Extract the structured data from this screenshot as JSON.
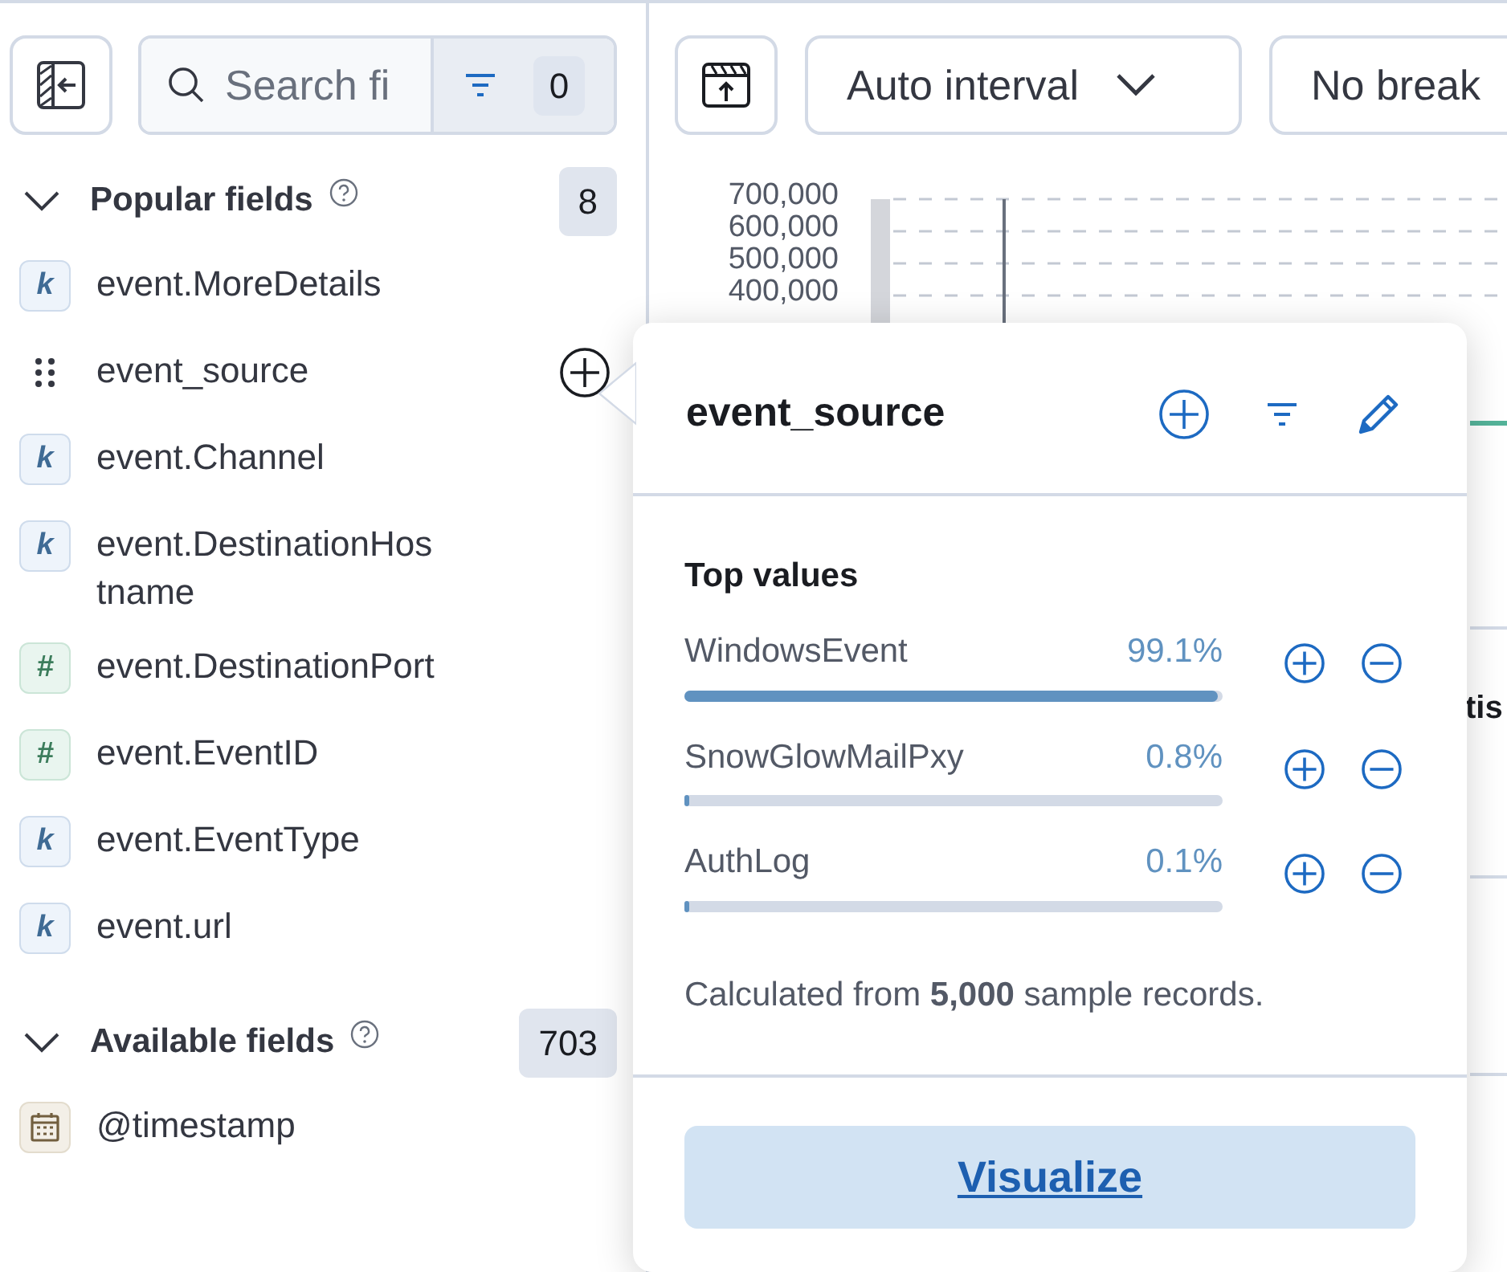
{
  "sidebar": {
    "search": {
      "placeholder": "Search fi"
    },
    "filter_count": "0",
    "sections": [
      {
        "title": "Popular fields",
        "count": "8",
        "expanded": true,
        "fields": [
          {
            "name": "event.MoreDetails",
            "kind": "keyword",
            "type_label": "k",
            "hovered": false
          },
          {
            "name": "event_source",
            "hovered": true
          },
          {
            "name": "event.Channel",
            "kind": "keyword",
            "type_label": "k",
            "hovered": false
          },
          {
            "name": "event.DestinationHostname",
            "kind": "keyword",
            "type_label": "k",
            "hovered": false
          },
          {
            "name": "event.DestinationPort",
            "kind": "number",
            "type_label": "#",
            "hovered": false
          },
          {
            "name": "event.EventID",
            "kind": "number",
            "type_label": "#",
            "hovered": false
          },
          {
            "name": "event.EventType",
            "kind": "keyword",
            "type_label": "k",
            "hovered": false
          },
          {
            "name": "event.url",
            "kind": "keyword",
            "type_label": "k",
            "hovered": false
          }
        ]
      },
      {
        "title": "Available fields",
        "count": "703",
        "expanded": true,
        "fields": [
          {
            "name": "@timestamp",
            "kind": "date",
            "hovered": false
          }
        ]
      }
    ]
  },
  "toolbar": {
    "interval": "Auto interval",
    "breakdown": "No break"
  },
  "chart": {
    "y_axis_labels": [
      "700,000",
      "600,000",
      "500,000",
      "400,000"
    ]
  },
  "background_fragment": "tis",
  "popover": {
    "title": "event_source",
    "section_title": "Top values",
    "values": [
      {
        "name": "WindowsEvent",
        "percent": "99.1%",
        "level": 0.991
      },
      {
        "name": "SnowGlowMailPxy",
        "percent": "0.8%",
        "level": 0.008
      },
      {
        "name": "AuthLog",
        "percent": "0.1%",
        "level": 0.001
      }
    ],
    "footer": "Calculated from **5,000** sample records.",
    "button": "Visualize"
  }
}
